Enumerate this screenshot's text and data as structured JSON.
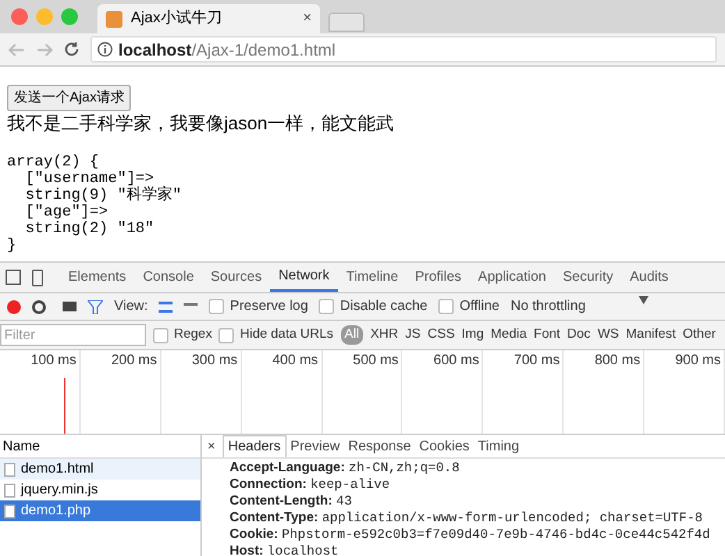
{
  "browser_tab": {
    "title": "Ajax小试牛刀",
    "close": "×"
  },
  "address": {
    "host": "localhost",
    "path": "/Ajax-1/demo1.html"
  },
  "page": {
    "button": "发送一个Ajax请求",
    "message": "我不是二手科学家，我要像jason一样，能文能武",
    "dump": [
      "array(2) {",
      "  [\"username\"]=>",
      "  string(9) \"科学家\"",
      "  [\"age\"]=>",
      "  string(2) \"18\"",
      "}"
    ]
  },
  "devtools": {
    "tabs": [
      {
        "label": "Elements",
        "selected": false
      },
      {
        "label": "Console",
        "selected": false
      },
      {
        "label": "Sources",
        "selected": false
      },
      {
        "label": "Network",
        "selected": true
      },
      {
        "label": "Timeline",
        "selected": false
      },
      {
        "label": "Profiles",
        "selected": false
      },
      {
        "label": "Application",
        "selected": false
      },
      {
        "label": "Security",
        "selected": false
      },
      {
        "label": "Audits",
        "selected": false
      }
    ],
    "toolbar": {
      "recording": true,
      "view_label": "View:",
      "options": [
        {
          "label": "Preserve log",
          "checked": false
        },
        {
          "label": "Disable cache",
          "checked": false
        },
        {
          "label": "Offline",
          "checked": false
        }
      ],
      "throttling": "No throttling"
    },
    "filter": {
      "placeholder": "Filter",
      "regex": {
        "label": "Regex",
        "checked": false
      },
      "hide_data_urls": {
        "label": "Hide data URLs",
        "checked": false
      },
      "types": [
        {
          "label": "All",
          "selected": true
        },
        {
          "label": "XHR",
          "selected": false
        },
        {
          "label": "JS",
          "selected": false
        },
        {
          "label": "CSS",
          "selected": false
        },
        {
          "label": "Img",
          "selected": false
        },
        {
          "label": "Media",
          "selected": false
        },
        {
          "label": "Font",
          "selected": false
        },
        {
          "label": "Doc",
          "selected": false
        },
        {
          "label": "WS",
          "selected": false
        },
        {
          "label": "Manifest",
          "selected": false
        },
        {
          "label": "Other",
          "selected": false
        }
      ]
    },
    "timeline_ticks": [
      "100 ms",
      "200 ms",
      "300 ms",
      "400 ms",
      "500 ms",
      "600 ms",
      "700 ms",
      "800 ms",
      "900 ms"
    ],
    "requests": {
      "header": "Name",
      "rows": [
        {
          "name": "demo1.html",
          "selected": false
        },
        {
          "name": "jquery.min.js",
          "selected": false
        },
        {
          "name": "demo1.php",
          "selected": true
        }
      ]
    },
    "detail": {
      "close": "×",
      "tabs": [
        {
          "label": "Headers",
          "selected": true
        },
        {
          "label": "Preview",
          "selected": false
        },
        {
          "label": "Response",
          "selected": false
        },
        {
          "label": "Cookies",
          "selected": false
        },
        {
          "label": "Timing",
          "selected": false
        }
      ],
      "headers": [
        {
          "name": "Accept-Language:",
          "value": "zh-CN,zh;q=0.8"
        },
        {
          "name": "Connection:",
          "value": "keep-alive"
        },
        {
          "name": "Content-Length:",
          "value": "43"
        },
        {
          "name": "Content-Type:",
          "value": "application/x-www-form-urlencoded; charset=UTF-8"
        },
        {
          "name": "Cookie:",
          "value": "Phpstorm-e592c0b3=f7e09d40-7e9b-4746-bd4c-0ce44c542f4d"
        },
        {
          "name": "Host:",
          "value": "localhost"
        }
      ]
    }
  }
}
